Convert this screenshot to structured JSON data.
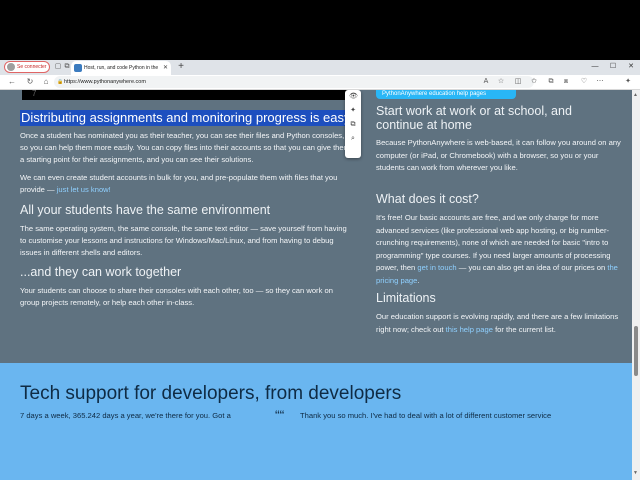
{
  "browser": {
    "profile_label": "Se connecter",
    "tab_title": "Host, run, and code Python in the",
    "tab_close": "✕",
    "new_tab": "+",
    "url": "https://www.pythonanywhere.com",
    "window_minimize": "—",
    "window_maximize": "☐",
    "window_close": "✕"
  },
  "page": {
    "top_black_char": "7",
    "top_banner": "PythonAnywhere education help pages",
    "selected_heading": "Distributing assignments and monitoring progress is easy",
    "left": {
      "p1": "Once a student has nominated you as their teacher, you can see their files and Python consoles, so you can help them more easily. You can copy files into their accounts so that you can give them a starting point for their assignments, and you can see their solutions.",
      "p2_pre": "We can even create student accounts in bulk for you, and pre-populate them with files that you provide — ",
      "p2_link": "just let us know!",
      "h_env": "All your students have the same environment",
      "p3": "The same operating system, the same console, the same text editor — save yourself from having to customise your lessons and instructions for Windows/Mac/Linux, and from having to debug issues in different shells and editors.",
      "h_together": "...and they can work together",
      "p4": "Your students can choose to share their consoles with each other, too — so they can work on group projects remotely, or help each other in-class."
    },
    "right": {
      "h_start": "Start work at work or at school, and continue at home",
      "p_start": "Because PythonAnywhere is web-based, it can follow you around on any computer (or iPad, or Chromebook) with a browser, so you or your students can work from wherever you like.",
      "h_cost": "What does it cost?",
      "p_cost_1": "It's free! Our basic accounts are free, and we only charge for more advanced services (like professional web app hosting, or big number-crunching requirements), none of which are needed for basic \"intro to programming\" type courses. If you need larger amounts of processing power, then ",
      "p_cost_link1": "get in touch",
      "p_cost_2": " — you can also get an idea of our prices on ",
      "p_cost_link2": "the pricing page",
      "p_cost_3": ".",
      "h_limits": "Limitations",
      "p_limits_1": "Our education support is evolving rapidly, and there are a few limitations right now; check out ",
      "p_limits_link": "this help page",
      "p_limits_2": " for the current list."
    },
    "support": {
      "title": "Tech support for developers, from developers",
      "sub": "7 days a week, 365.242 days a year, we're there for you. Got a",
      "quote_mark": "““",
      "quote_text": "Thank you so much. I've had to deal with a lot of different customer service"
    }
  },
  "colors": {
    "page_bg": "#5f7280",
    "selection": "#1d4fbf",
    "link": "#8fd0ff",
    "support_bg": "#6ab6f0",
    "banner": "#29b6f6"
  }
}
